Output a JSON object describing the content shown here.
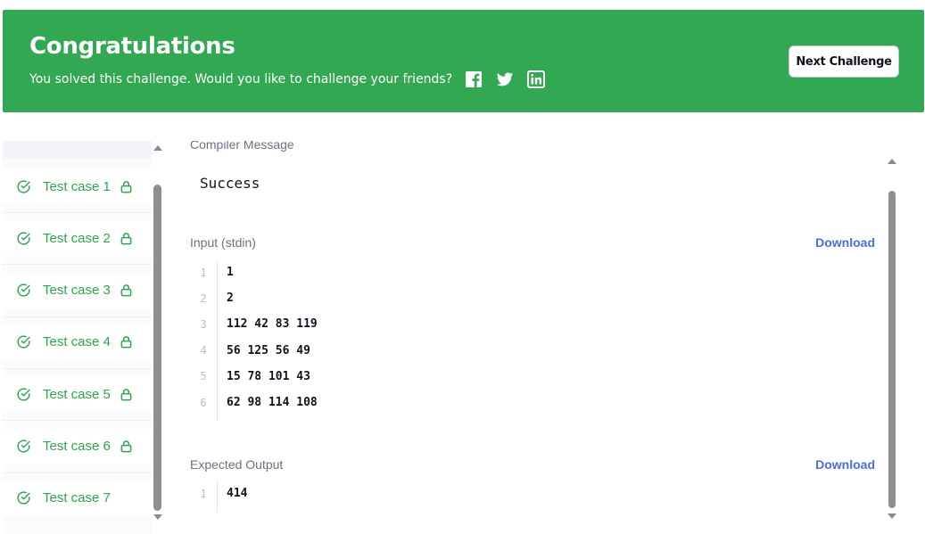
{
  "banner": {
    "title": "Congratulations",
    "subtitle": "You solved this challenge. Would you like to challenge your friends?",
    "share_icons": [
      "facebook-icon",
      "twitter-icon",
      "linkedin-icon"
    ],
    "next_button": "Next Challenge",
    "color": "#32a852"
  },
  "sidebar": {
    "test_cases": [
      {
        "label": "Test case 1",
        "locked": true
      },
      {
        "label": "Test case 2",
        "locked": true
      },
      {
        "label": "Test case 3",
        "locked": true
      },
      {
        "label": "Test case 4",
        "locked": true
      },
      {
        "label": "Test case 5",
        "locked": true
      },
      {
        "label": "Test case 6",
        "locked": true
      },
      {
        "label": "Test case 7",
        "locked": false
      }
    ],
    "accent": "#2ea44f"
  },
  "main": {
    "compiler_label": "Compiler Message",
    "compiler_message": "Success",
    "input": {
      "label": "Input (stdin)",
      "download": "Download",
      "lines": [
        "1",
        "2",
        "112 42 83 119",
        "56 125 56 49",
        "15 78 101 43",
        "62 98 114 108"
      ]
    },
    "expected": {
      "label": "Expected Output",
      "download": "Download",
      "lines": [
        "414"
      ]
    },
    "link_color": "#4a6ee0"
  }
}
